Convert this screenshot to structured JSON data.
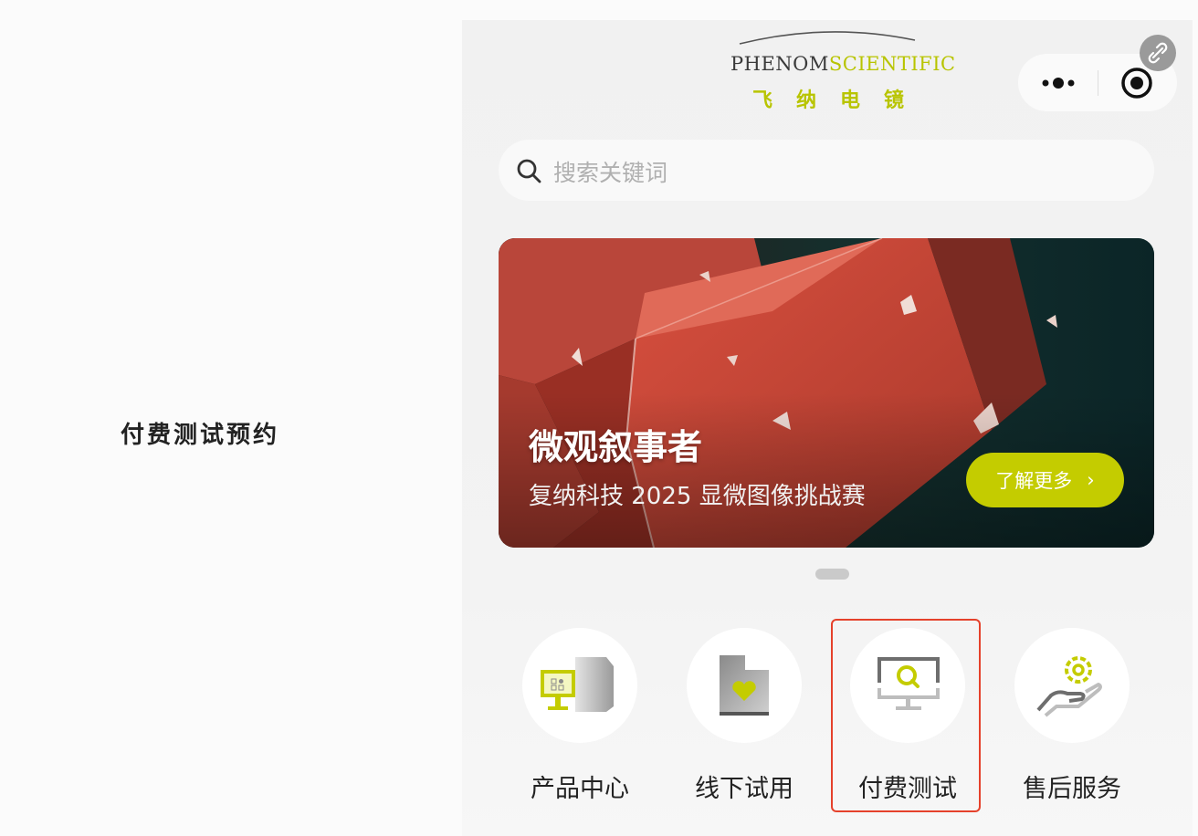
{
  "caption": "付费测试预约",
  "header": {
    "logo_en_part1": "PHENOM",
    "logo_en_part2": "SCIENTIFIC",
    "logo_cn": "飞纳电镜"
  },
  "search": {
    "placeholder": "搜索关键词"
  },
  "banner": {
    "title": "微观叙事者",
    "subtitle": "复纳科技 2025 显微图像挑战赛",
    "cta_label": "了解更多",
    "cta_arrow": "›"
  },
  "quick_entries": [
    {
      "label": "产品中心",
      "icon": "product-center-icon"
    },
    {
      "label": "线下试用",
      "icon": "offline-trial-icon"
    },
    {
      "label": "付费测试",
      "icon": "paid-test-icon",
      "highlighted": true
    },
    {
      "label": "售后服务",
      "icon": "after-sales-icon"
    }
  ],
  "colors": {
    "brand_green": "#c4cc00",
    "highlight_red": "#e5412b"
  }
}
